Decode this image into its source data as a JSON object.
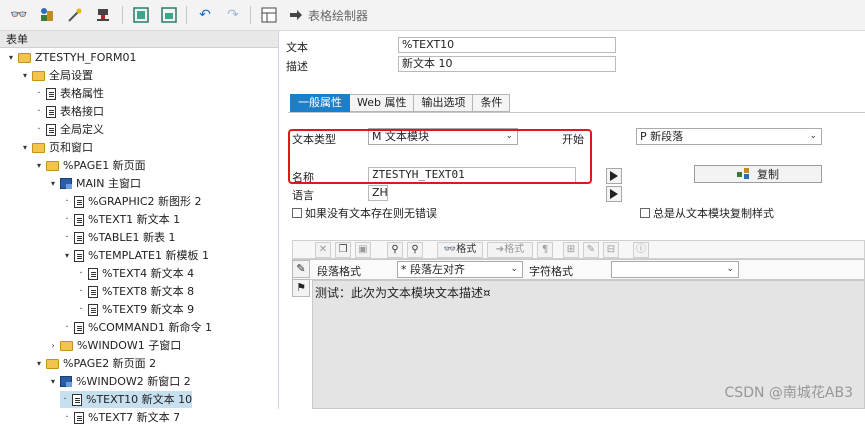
{
  "toolbar": {
    "title": "表格绘制器",
    "icons": [
      "glasses-icon",
      "objects-icon",
      "wand-icon",
      "stamp-icon",
      "export-icon",
      "import-icon",
      "undo-icon",
      "redo-icon",
      "layout-icon",
      "arrow-right-icon"
    ]
  },
  "tree": {
    "header": "表单",
    "rows": [
      {
        "label": "ZTESTYH_FORM01",
        "icon": "folder-icon"
      },
      {
        "label": "全局设置",
        "icon": "folder-icon"
      },
      {
        "label": "表格属性",
        "icon": "document-icon"
      },
      {
        "label": "表格接口",
        "icon": "document-icon"
      },
      {
        "label": "全局定义",
        "icon": "document-icon"
      },
      {
        "label": "页和窗口",
        "icon": "folder-icon"
      },
      {
        "label": "%PAGE1 新页面",
        "icon": "folder-icon"
      },
      {
        "label": "MAIN 主窗口",
        "icon": "window-icon"
      },
      {
        "label": "%GRAPHIC2 新图形 2",
        "icon": "graphic-icon"
      },
      {
        "label": "%TEXT1 新文本 1",
        "icon": "text-icon"
      },
      {
        "label": "%TABLE1 新表 1",
        "icon": "table-icon"
      },
      {
        "label": "%TEMPLATE1 新模板 1",
        "icon": "template-icon"
      },
      {
        "label": "%TEXT4 新文本 4",
        "icon": "text-icon"
      },
      {
        "label": "%TEXT8 新文本 8",
        "icon": "text-icon"
      },
      {
        "label": "%TEXT9 新文本 9",
        "icon": "text-icon"
      },
      {
        "label": "%COMMAND1 新命令 1",
        "icon": "command-icon"
      },
      {
        "label": "%WINDOW1 子窗口",
        "icon": "subwindow-icon"
      },
      {
        "label": "%PAGE2 新页面 2",
        "icon": "folder-icon"
      },
      {
        "label": "%WINDOW2 新窗口 2",
        "icon": "window-icon"
      },
      {
        "label": "%TEXT10 新文本 10",
        "icon": "text-icon",
        "selected": true
      },
      {
        "label": "%TEXT7 新文本 7",
        "icon": "text-icon"
      }
    ]
  },
  "header": {
    "text_label": "文本",
    "text_value": "%TEXT10",
    "desc_label": "描述",
    "desc_value": "新文本 10"
  },
  "tabs": [
    "一般属性",
    "Web 属性",
    "输出选项",
    "条件"
  ],
  "general": {
    "text_type_label": "文本类型",
    "text_type_value": "M 文本模块",
    "start_label": "开始",
    "start_value": "P 新段落",
    "name_label": "名称",
    "name_value": "ZTESTYH_TEXT01",
    "copy_button": "复制",
    "language_label": "语言",
    "language_value": "ZH",
    "no_error_checkbox": "如果没有文本存在则无错误",
    "always_copy_checkbox": "总是从文本模块复制样式"
  },
  "editor": {
    "toolbar_format": "格式",
    "toolbar_format2": "格式",
    "para_format_label": "段落格式",
    "para_format_value": "* 段落左对齐",
    "char_format_label": "字符格式",
    "char_format_value": "",
    "content": "测试：此次为文本模块文本描述¤"
  },
  "watermark": "CSDN @南城花AB3",
  "colors": {
    "accent": "#1e7fc9",
    "highlight": "#e01818",
    "selection": "#c7e0f0"
  }
}
